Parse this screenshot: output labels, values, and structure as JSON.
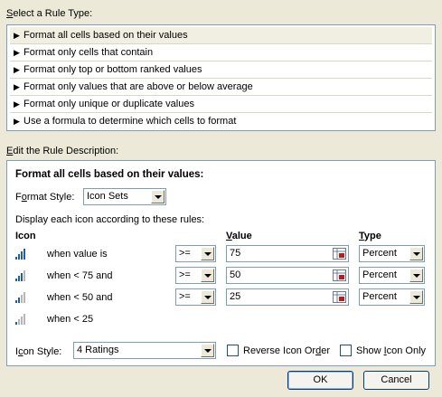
{
  "section1_label_prefix": "S",
  "section1_label_rest": "elect a Rule Type:",
  "rule_types": [
    "Format all cells based on their values",
    "Format only cells that contain",
    "Format only top or bottom ranked values",
    "Format only values that are above or below average",
    "Format only unique or duplicate values",
    "Use a formula to determine which cells to format"
  ],
  "section2_label_prefix": "E",
  "section2_label_rest": "dit the Rule Description:",
  "description_title": "Format all cells based on their values:",
  "format_style_label_pre": "F",
  "format_style_label_u": "o",
  "format_style_label_post": "rmat Style:",
  "format_style_value": "Icon Sets",
  "display_rules_text": "Display each icon according to these rules:",
  "columns": {
    "icon": "Icon",
    "value_u": "V",
    "value_rest": "alue",
    "type_u": "T",
    "type_rest": "ype"
  },
  "rules": [
    {
      "condition": "when value is",
      "operator": ">=",
      "value": "75",
      "type": "Percent"
    },
    {
      "condition": "when < 75 and",
      "operator": ">=",
      "value": "50",
      "type": "Percent"
    },
    {
      "condition": "when < 50 and",
      "operator": ">=",
      "value": "25",
      "type": "Percent"
    }
  ],
  "last_rule_condition": "when < 25",
  "icon_style_label_pre": "I",
  "icon_style_label_u": "c",
  "icon_style_label_post": "on Style:",
  "icon_style_value": "4 Ratings",
  "reverse_label_pre": "Reverse Icon Or",
  "reverse_label_u": "d",
  "reverse_label_post": "er",
  "show_icon_only_pre": "Show ",
  "show_icon_only_u": "I",
  "show_icon_only_post": "con Only",
  "ok_label": "OK",
  "cancel_label": "Cancel",
  "colors": {
    "dialog_bg": "#ece9d8",
    "border": "#7f9db9",
    "icon_blue": "#1f5fa8",
    "icon_gray": "#b7b7b7",
    "ref_red": "#c4161c"
  }
}
